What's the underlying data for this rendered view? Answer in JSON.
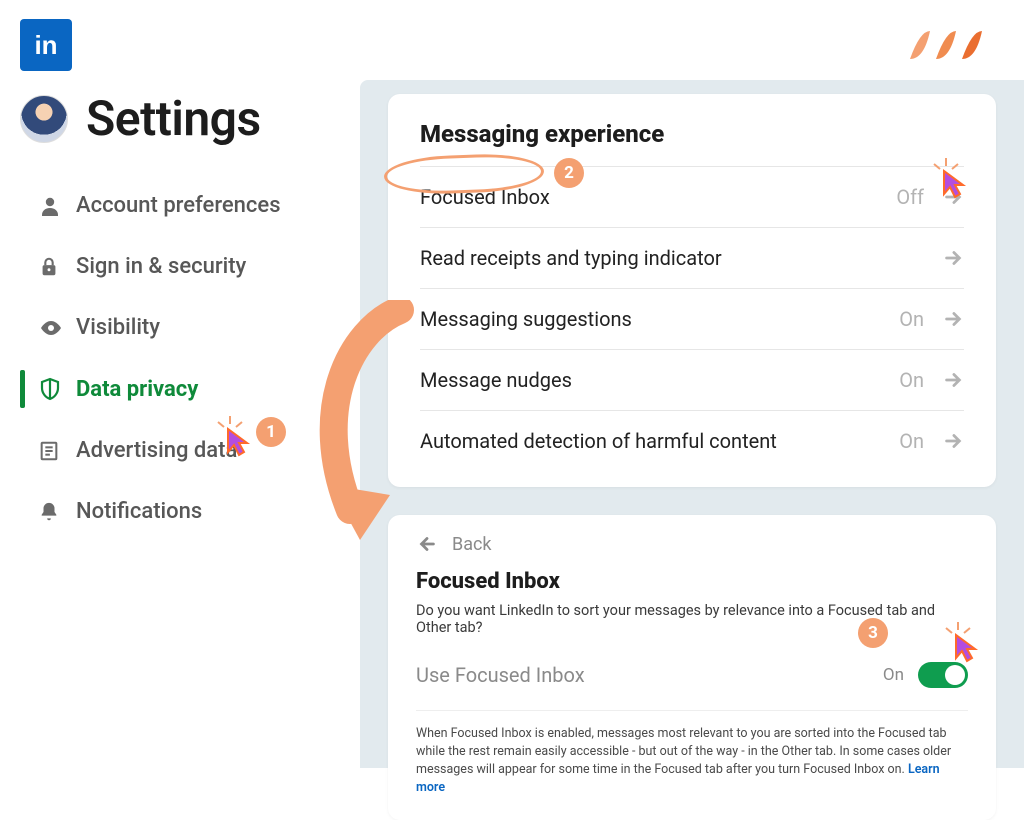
{
  "header": {
    "logo_text": "in"
  },
  "sidebar": {
    "title": "Settings",
    "items": [
      {
        "label": "Account preferences"
      },
      {
        "label": "Sign in & security"
      },
      {
        "label": "Visibility"
      },
      {
        "label": "Data privacy"
      },
      {
        "label": "Advertising data"
      },
      {
        "label": "Notifications"
      }
    ]
  },
  "panel1": {
    "title": "Messaging experience",
    "rows": [
      {
        "label": "Focused Inbox",
        "value": "Off"
      },
      {
        "label": "Read receipts and typing indicator",
        "value": ""
      },
      {
        "label": "Messaging suggestions",
        "value": "On"
      },
      {
        "label": "Message nudges",
        "value": "On"
      },
      {
        "label": "Automated detection of harmful content",
        "value": "On"
      }
    ]
  },
  "panel2": {
    "back": "Back",
    "title": "Focused Inbox",
    "subtitle": "Do you want LinkedIn to sort your messages by relevance into a Focused tab and Other tab?",
    "toggle_label": "Use Focused Inbox",
    "toggle_state": "On",
    "note": "When Focused Inbox is enabled, messages most relevant to you are sorted into the Focused tab while the rest remain easily accessible - but out of the way - in the Other tab. In some cases older messages will appear for some time in the Focused tab after you turn Focused Inbox on. ",
    "learn_more": "Learn more"
  },
  "steps": {
    "one": "1",
    "two": "2",
    "three": "3"
  }
}
